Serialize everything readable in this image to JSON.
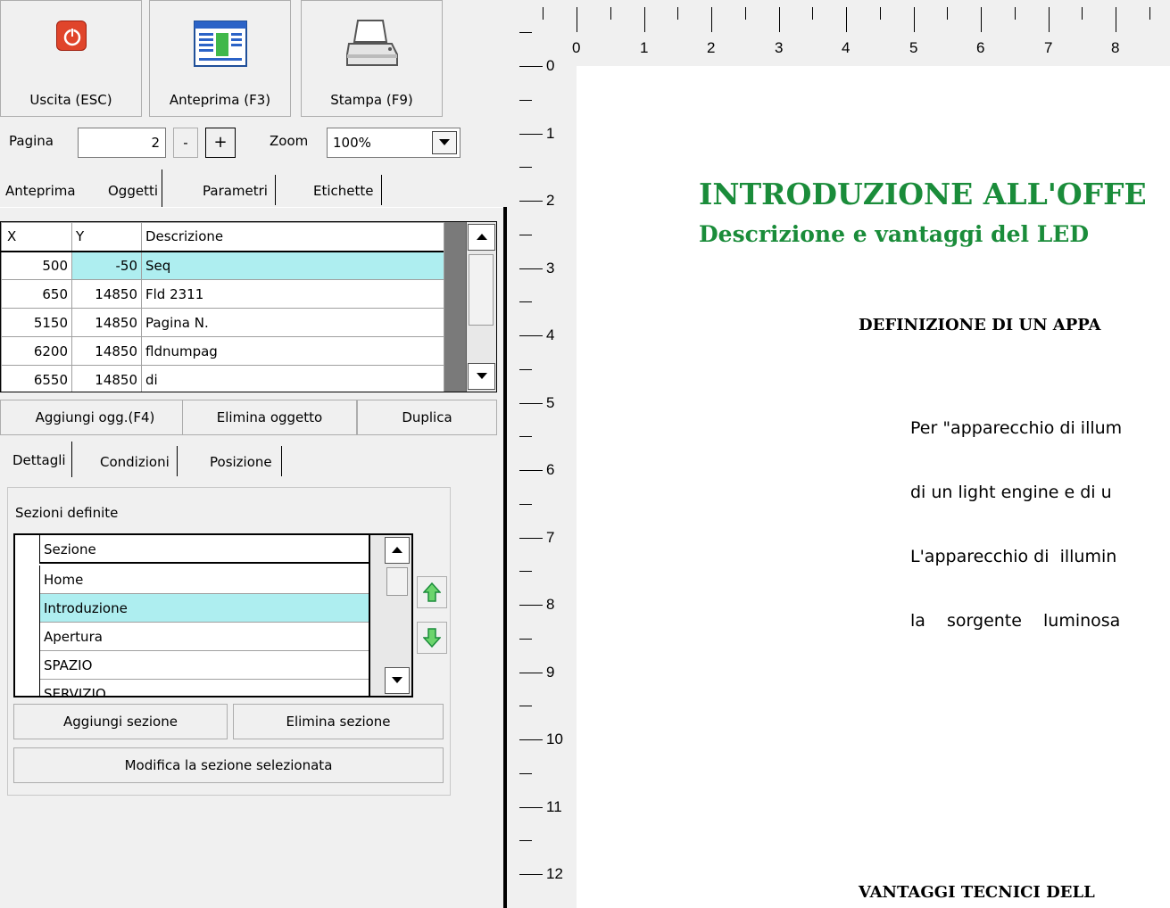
{
  "toolbar": {
    "exit_label": "Uscita (ESC)",
    "preview_label": "Anteprima (F3)",
    "print_label": "Stampa (F9)"
  },
  "pager": {
    "page_label": "Pagina",
    "page_value": "2",
    "minus_label": "-",
    "plus_label": "+",
    "zoom_label": "Zoom",
    "zoom_value": "100%"
  },
  "tabs": [
    "Anteprima",
    "Oggetti",
    "Parametri",
    "Etichette"
  ],
  "objects_grid": {
    "columns": [
      "X",
      "Y",
      "Descrizione"
    ],
    "rows": [
      {
        "x": "500",
        "y": "-50",
        "desc": "Seq"
      },
      {
        "x": "650",
        "y": "14850",
        "desc": "Fld 2311"
      },
      {
        "x": "5150",
        "y": "14850",
        "desc": "Pagina N."
      },
      {
        "x": "6200",
        "y": "14850",
        "desc": "fldnumpag"
      },
      {
        "x": "6550",
        "y": "14850",
        "desc": "di"
      }
    ],
    "selected_row": 0
  },
  "object_buttons": {
    "add": "Aggiungi ogg.(F4)",
    "delete": "Elimina oggetto",
    "duplicate": "Duplica"
  },
  "subtabs": [
    "Dettagli",
    "Condizioni",
    "Posizione"
  ],
  "sections": {
    "group_label": "Sezioni definite",
    "column": "Sezione",
    "items": [
      "Home",
      "Introduzione",
      "Apertura",
      "SPAZIO",
      "SERVIZIO"
    ],
    "selected": 1,
    "add": "Aggiungi sezione",
    "delete": "Elimina sezione",
    "modify": "Modifica la sezione selezionata"
  },
  "ruler": {
    "top_numbers": [
      "0",
      "1",
      "2",
      "3",
      "4",
      "5",
      "6",
      "7",
      "8"
    ],
    "left_numbers": [
      "0",
      "1",
      "2",
      "3",
      "4",
      "5",
      "6",
      "7",
      "8",
      "9",
      "10",
      "11",
      "12"
    ]
  },
  "document": {
    "title": "INTRODUZIONE ALL'OFFE",
    "subtitle": "Descrizione e vantaggi del LED",
    "heading1": "DEFINIZIONE DI UN APPA",
    "paragraph_lines": [
      "Per \"apparecchio di illum",
      "di un light engine e di u",
      "L'apparecchio di  illumin",
      "la  sorgente  luminosa"
    ],
    "heading2": "VANTAGGI TECNICI DELL"
  },
  "colors": {
    "title_green": "#1a8c3a",
    "selection": "#aeeef0",
    "exit_icon": "#e0452b"
  }
}
